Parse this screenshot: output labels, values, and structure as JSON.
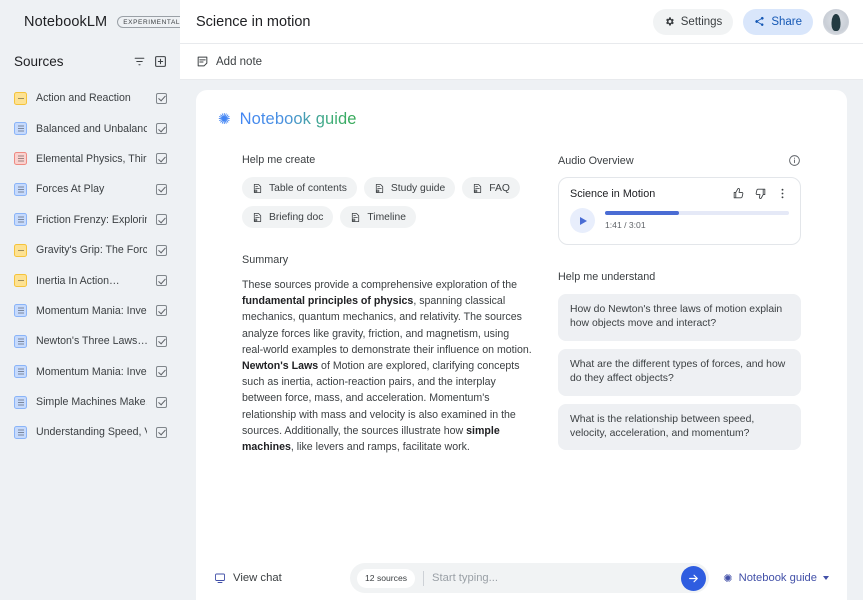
{
  "app": {
    "brand": "NotebookLM",
    "experimental_badge": "EXPERIMENTAL",
    "notebook_title": "Science in motion",
    "accent_blue": "#4285f4",
    "accent_green": "#34a853",
    "send_blue": "#2f5de0"
  },
  "topbar": {
    "settings_label": "Settings",
    "share_label": "Share"
  },
  "sidebar": {
    "heading": "Sources",
    "sources": [
      {
        "name": "Action and Reaction",
        "type": "note",
        "checked": true
      },
      {
        "name": "Balanced and Unbalance…",
        "type": "doc",
        "checked": true
      },
      {
        "name": "Elemental Physics, Third…",
        "type": "pdf",
        "checked": true
      },
      {
        "name": "Forces At Play",
        "type": "doc",
        "checked": true
      },
      {
        "name": "Friction Frenzy: Explorin…",
        "type": "doc",
        "checked": true
      },
      {
        "name": "Gravity's Grip: The Force…",
        "type": "note",
        "checked": true
      },
      {
        "name": "Inertia In Action…",
        "type": "note",
        "checked": true
      },
      {
        "name": "Momentum Mania: Inves…",
        "type": "doc",
        "checked": true
      },
      {
        "name": "Newton's Three Laws…",
        "type": "doc",
        "checked": true
      },
      {
        "name": "Momentum Mania: Inves…",
        "type": "doc",
        "checked": true
      },
      {
        "name": "Simple Machines Make…",
        "type": "doc",
        "checked": true
      },
      {
        "name": "Understanding Speed, Ve…",
        "type": "doc",
        "checked": true
      }
    ]
  },
  "notebar": {
    "add_note_label": "Add note"
  },
  "guide": {
    "title": "Notebook guide",
    "help_create_label": "Help me create",
    "create_chips": [
      "Table of contents",
      "Study guide",
      "FAQ",
      "Briefing doc",
      "Timeline"
    ],
    "summary_label": "Summary",
    "summary_parts": [
      {
        "text": "These sources provide a comprehensive exploration of the ",
        "bold": false
      },
      {
        "text": "fundamental principles of physics",
        "bold": true
      },
      {
        "text": ", spanning classical mechanics, quantum mechanics, and relativity. The sources analyze forces like gravity, friction, and magnetism, using real-world examples to demonstrate their influence on motion. ",
        "bold": false
      },
      {
        "text": "Newton's Laws",
        "bold": true
      },
      {
        "text": " of Motion are explored, clarifying concepts such as inertia, action-reaction pairs, and the interplay between force, mass, and acceleration. Momentum's relationship with mass and velocity is also examined in the sources. Additionally, the sources illustrate how ",
        "bold": false
      },
      {
        "text": "simple machines",
        "bold": true
      },
      {
        "text": ", like levers and ramps, facilitate work.",
        "bold": false
      }
    ],
    "audio_overview_label": "Audio Overview",
    "audio": {
      "title": "Science in Motion",
      "elapsed": "1:41",
      "duration": "3:01",
      "time_display": "1:41 / 3:01",
      "progress_percent": 40
    },
    "help_understand_label": "Help me understand",
    "questions": [
      "How do Newton's three laws of motion explain how objects move and interact?",
      "What are the different types of forces, and how do they affect objects?",
      "What is the relationship between speed, velocity, acceleration, and momentum?"
    ]
  },
  "bottombar": {
    "view_chat_label": "View chat",
    "sources_badge": "12 sources",
    "input_placeholder": "Start typing...",
    "input_value": "",
    "guide_toggle_label": "Notebook guide"
  }
}
